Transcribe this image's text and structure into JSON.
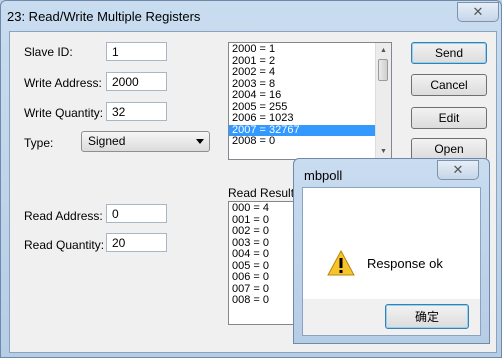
{
  "window": {
    "title": "23: Read/Write Multiple Registers",
    "close_glyph": "✕"
  },
  "form": {
    "slave_id_label": "Slave ID:",
    "slave_id": "1",
    "write_address_label": "Write Address:",
    "write_address": "2000",
    "write_quantity_label": "Write Quantity:",
    "write_quantity": "32",
    "type_label": "Type:",
    "type_value": "Signed",
    "read_address_label": "Read Address:",
    "read_address": "0",
    "read_quantity_label": "Read Quantity:",
    "read_quantity": "20"
  },
  "write_list": [
    "2000 = 1",
    "2001 = 2",
    "2002 = 4",
    "2003 = 8",
    "2004 = 16",
    "2005 = 255",
    "2006 = 1023",
    "2007 = 32767",
    "2008 = 0"
  ],
  "write_selected_index": 7,
  "read_result": {
    "label": "Read Result",
    "items": [
      "000 = 4",
      "001 = 0",
      "002 = 0",
      "003 = 0",
      "004 = 0",
      "005 = 0",
      "006 = 0",
      "007 = 0",
      "008 = 0"
    ]
  },
  "buttons": {
    "send": "Send",
    "cancel": "Cancel",
    "edit": "Edit",
    "open": "Open"
  },
  "dialog": {
    "title": "mbpoll",
    "message": "Response ok",
    "ok": "确定",
    "close_glyph": "✕"
  }
}
